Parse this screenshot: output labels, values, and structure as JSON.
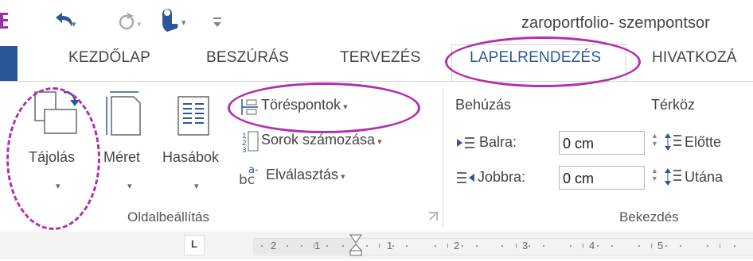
{
  "title_bar": {
    "document_title": "zaroportfolio- szempontsor",
    "undo_icon": "undo-icon",
    "redo_icon": "redo-icon",
    "touch_icon": "touch-mode-icon",
    "customize_icon": "customize-qat-icon"
  },
  "tabs": [
    {
      "label": "KEZDŐLAP"
    },
    {
      "label": "BESZÚRÁS"
    },
    {
      "label": "TERVEZÉS"
    },
    {
      "label": "LAPELRENDEZÉS"
    },
    {
      "label": "HIVATKOZÁ"
    }
  ],
  "page_setup": {
    "orientation_label": "Tájolás",
    "size_label": "Méret",
    "columns_label": "Hasábok",
    "breaks_label": "Töréspontok",
    "line_numbers_label": "Sorok számozása",
    "hyphenation_label": "Elválasztás",
    "group_label": "Oldalbeállítás"
  },
  "paragraph": {
    "indent_header": "Behúzás",
    "spacing_header": "Térköz",
    "left_label": "Balra:",
    "left_value": "0 cm",
    "right_label": "Jobbra:",
    "right_value": "0 cm",
    "before_label": "Előtte",
    "after_label": "Utána",
    "group_label": "Bekezdés"
  },
  "ruler": {
    "tab_selector": "L",
    "numbers": [
      "2",
      "1",
      "1",
      "2",
      "3",
      "4",
      "5"
    ]
  },
  "colors": {
    "accent": "#2b579a",
    "annotation": "#b030b0"
  }
}
